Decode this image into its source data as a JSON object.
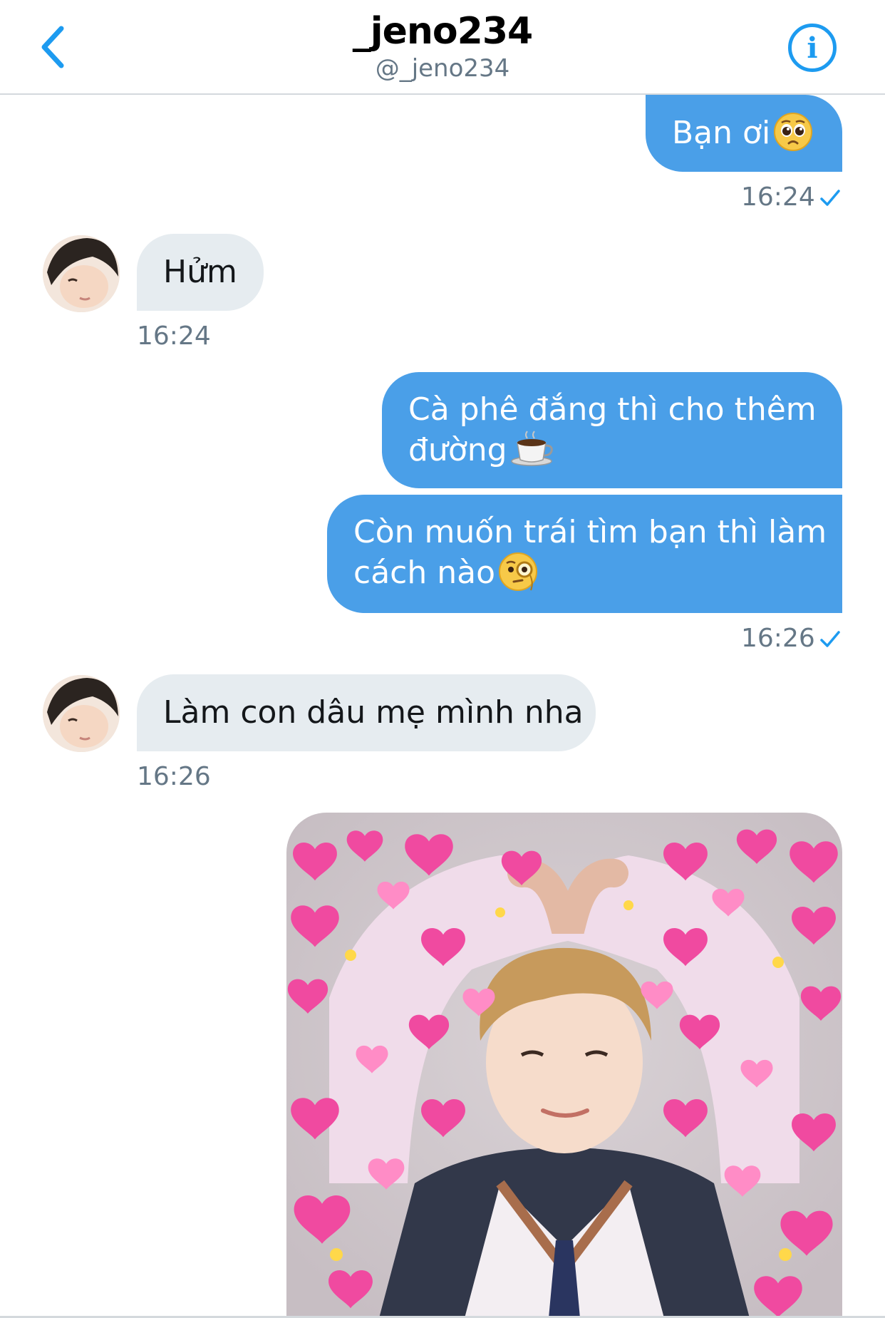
{
  "header": {
    "title": "_jeno234",
    "handle": "@_jeno234"
  },
  "messages": [
    {
      "direction": "sent",
      "text": "Bạn ơi",
      "emoji": "pleading-face"
    },
    {
      "direction": "sent",
      "time": "16:24",
      "status": "read"
    },
    {
      "direction": "received",
      "text": "Hửm",
      "time": "16:24"
    },
    {
      "direction": "sent",
      "text": "Cà phê đắng thì cho thêm đường",
      "line1": "Cà phê đắng thì cho thêm",
      "line2": "đường",
      "emoji": "coffee"
    },
    {
      "direction": "sent",
      "text": "Còn muốn trái tìm bạn thì làm cách nào",
      "line1": "Còn muốn trái tìm bạn thì làm",
      "line2": "cách nào",
      "emoji": "monocle-face",
      "time": "16:26",
      "status": "read"
    },
    {
      "direction": "received",
      "text": "Làm con dâu mẹ mình nha",
      "time": "16:26"
    },
    {
      "direction": "sent",
      "type": "image",
      "description": "heart-frame-meme-photo"
    }
  ],
  "colors": {
    "sent_bubble": "#4a9fe8",
    "received_bubble": "#e6ecf0",
    "accent": "#1d9bf0",
    "timestamp": "#657786"
  }
}
